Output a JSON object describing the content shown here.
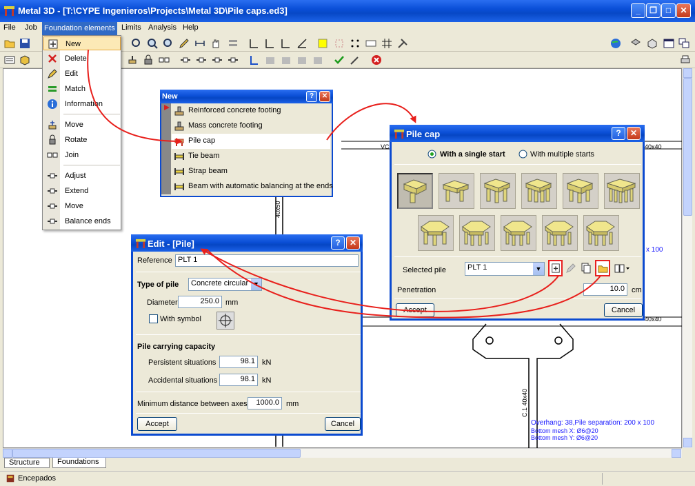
{
  "window": {
    "title": "Metal 3D - [T:\\CYPE Ingenieros\\Projects\\Metal 3D\\Pile caps.ed3]",
    "min": "_",
    "max": "□",
    "close": "✕"
  },
  "menubar": [
    "File",
    "Job",
    "Foundation elements",
    "Limits",
    "Analysis",
    "Help"
  ],
  "dropdown": {
    "items": [
      "New",
      "Delete",
      "Edit",
      "Match",
      "Information",
      "Move",
      "Rotate",
      "Join",
      "Adjust",
      "Extend",
      "Move",
      "Balance ends"
    ]
  },
  "new_dialog": {
    "title": "New",
    "items": [
      "Reinforced concrete footing",
      "Mass concrete footing",
      "Pile cap",
      "Tie beam",
      "Strap beam",
      "Beam with automatic balancing at the ends"
    ]
  },
  "pilecap_dialog": {
    "title": "Pile cap",
    "radio_single": "With a single start",
    "radio_multiple": "With multiple starts",
    "selected_pile_label": "Selected pile",
    "selected_pile_value": "PLT 1",
    "penetration_label": "Penetration",
    "penetration_value": "10.0",
    "penetration_unit": "cm",
    "accept": "Accept",
    "cancel": "Cancel"
  },
  "edit_dialog": {
    "title": "Edit - [Pile]",
    "reference_label": "Reference",
    "reference_value": "PLT 1",
    "type_label": "Type of pile",
    "type_value": "Concrete circular",
    "diameter_label": "Diameter",
    "diameter_value": "250.0",
    "diameter_unit": "mm",
    "with_symbol": "With symbol",
    "capacity_label": "Pile carrying capacity",
    "persistent_label": "Persistent situations",
    "persistent_value": "98.1",
    "persistent_unit": "kN",
    "accidental_label": "Accidental situations",
    "accidental_value": "98.1",
    "accidental_unit": "kN",
    "min_dist_label": "Minimum distance between axes",
    "min_dist_value": "1000.0",
    "min_dist_unit": "mm",
    "accept": "Accept",
    "cancel": "Cancel"
  },
  "canvas": {
    "vc_label": "VC",
    "dim_top_right": "40x40",
    "dim_mid_right": "40x40",
    "dim_vertical": "40x50",
    "pile_sep_partial": "x 100",
    "column_label": "C.1  40x40",
    "overhang": "Overhang: 38,Pile separation: 200 x 100",
    "mesh_x": "Bottom mesh X: Ø6@20",
    "mesh_y": "Bottom mesh Y: Ø6@20"
  },
  "tabs": [
    "Structure",
    "Foundations"
  ],
  "status": "Encepados",
  "colors": {
    "titlebar": "#0b4fd6",
    "annotation_arrow": "#e8201c",
    "canvas_text_blue": "#1a1aff"
  }
}
